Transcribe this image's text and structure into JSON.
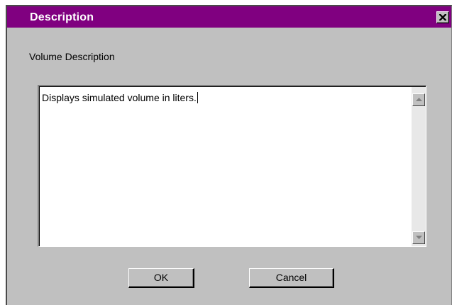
{
  "window": {
    "title": "Description",
    "title_bar_color": "#800080",
    "close_icon": "close-icon"
  },
  "field": {
    "label": "Volume Description",
    "value": "Displays simulated volume in liters."
  },
  "scrollbar": {
    "up_icon": "arrow-up-icon",
    "down_icon": "arrow-down-icon"
  },
  "buttons": {
    "ok_label": "OK",
    "cancel_label": "Cancel"
  }
}
